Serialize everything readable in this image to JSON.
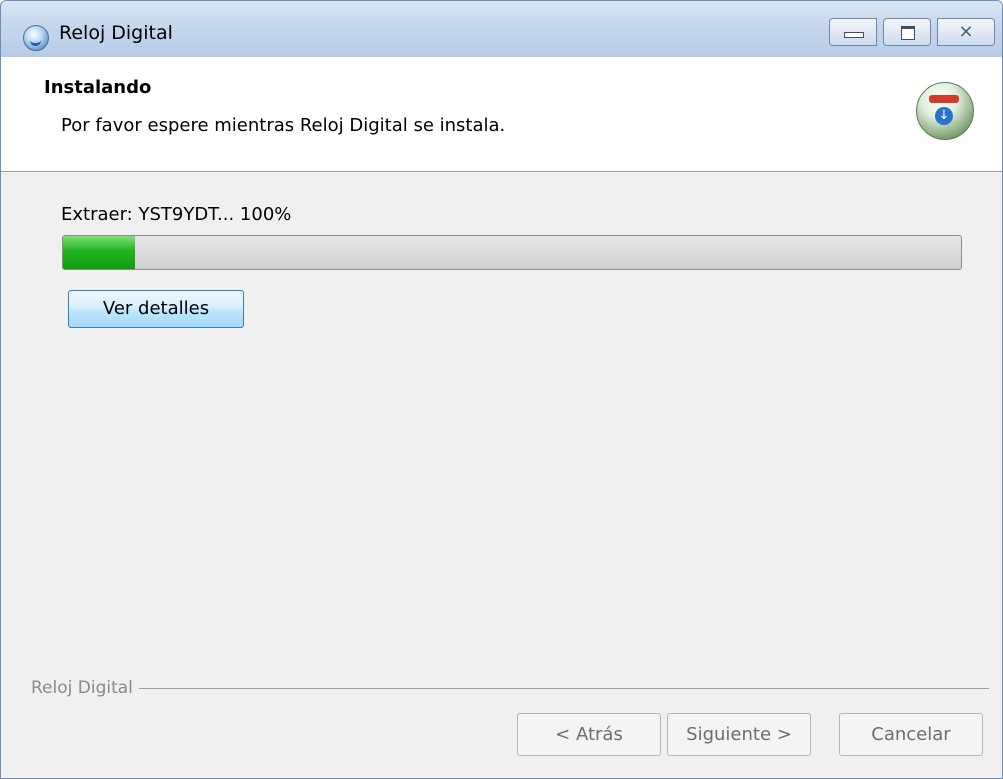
{
  "window": {
    "title": "Reloj Digital",
    "icon": "app-globe-icon",
    "controls": {
      "minimize": "minimize-icon",
      "maximize": "maximize-icon",
      "close_glyph": "⨯"
    }
  },
  "header": {
    "title": "Instalando",
    "subtitle": "Por favor espere mientras Reloj Digital se instala.",
    "icon": "installer-icon"
  },
  "progress": {
    "label": "Extraer: YST9YDT... 100%",
    "fill_fraction": 0.08,
    "fill_color": "#1fb01d"
  },
  "details_button": {
    "label": "Ver detalles"
  },
  "footer": {
    "brand": "Reloj Digital",
    "buttons": {
      "back": "< Atrás",
      "next": "Siguiente >",
      "cancel": "Cancelar"
    }
  }
}
